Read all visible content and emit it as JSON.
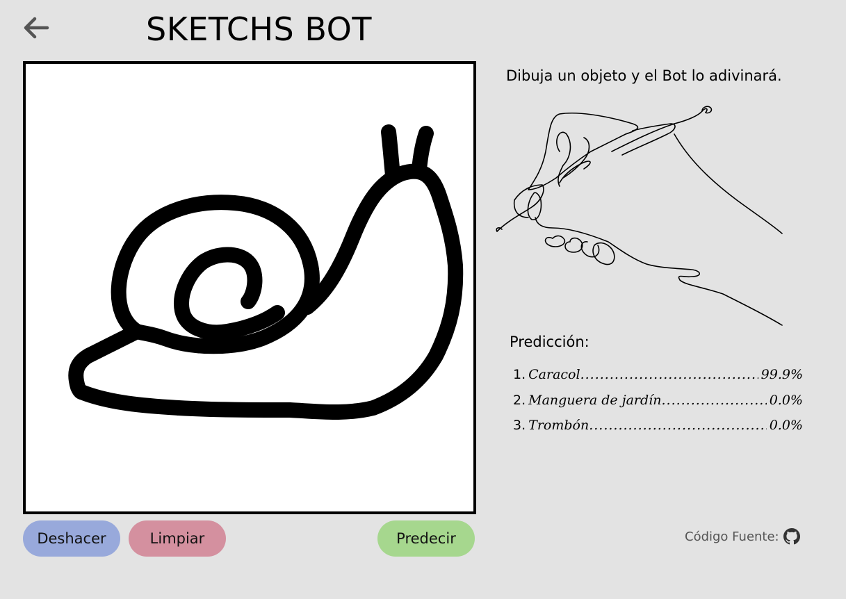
{
  "header": {
    "title": "SKETCHS BOT",
    "back_icon": "arrow-left-icon"
  },
  "canvas": {
    "background": "#ffffff",
    "stroke_color": "#000000",
    "drawing": "snail-sketch"
  },
  "controls": {
    "undo_label": "Deshacer",
    "clear_label": "Limpiar",
    "predict_label": "Predecir",
    "undo_color": "#98a9db",
    "clear_color": "#d4909f",
    "predict_color": "#a6d78e"
  },
  "side": {
    "instruction": "Dibuja un objeto y el Bot lo adivinará.",
    "illustration": "hand-drawing-pen-line-art",
    "prediction_title": "Predicción:"
  },
  "predictions": [
    {
      "rank": "1.",
      "label": "Caracol",
      "value": "99.9%"
    },
    {
      "rank": "2.",
      "label": "Manguera de jardín",
      "value": "0.0%"
    },
    {
      "rank": "3.",
      "label": "Trombón",
      "value": "0.0%"
    }
  ],
  "footer": {
    "source_label": "Código Fuente:",
    "source_icon": "github-icon"
  }
}
